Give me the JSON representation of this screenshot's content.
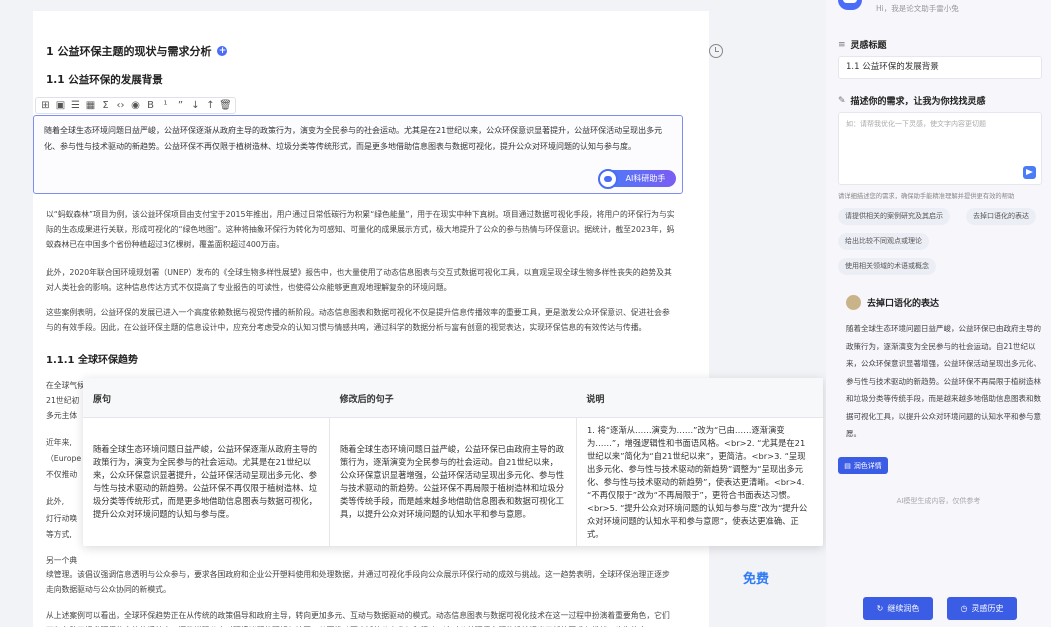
{
  "document": {
    "heading1": "1 公益环保主题的现状与需求分析",
    "heading2": "1.1 公益环保的发展背景",
    "heading3": "1.1.1 全球环保趋势",
    "editor_text": "随着全球生态环境问题日益严峻，公益环保逐渐从政府主导的政策行为，演变为全民参与的社会运动。尤其是在21世纪以来，公众环保意识显著提升，公益环保活动呈现出多元化、参与性与技术驱动的新趋势。公益环保不再仅限于植树造林、垃圾分类等传统形式，而是更多地借助信息图表与数据可视化，提升公众对环境问题的认知与参与度。",
    "ai_button_label": "AI科研助手",
    "para1": "以“蚂蚁森林”项目为例，该公益环保项目由支付宝于2015年推出，用户通过日常低碳行为积累“绿色能量”，用于在现实中种下真树。项目通过数据可视化手段，将用户的环保行为与实际的生态成果进行关联，形成可视化的“绿色地图”。这种将抽象环保行为转化为可感知、可量化的成果展示方式，极大地提升了公众的参与热情与环保意识。据统计，截至2023年，蚂蚁森林已在中国多个省份种植超过3亿棵树，覆盖面积超过400万亩。",
    "para2": "此外，2020年联合国环境规划署（UNEP）发布的《全球生物多样性展望》报告中，也大量使用了动态信息图表与交互式数据可视化工具，以直观呈现全球生物多样性丧失的趋势及其对人类社会的影响。这种信息传达方式不仅提高了专业报告的可读性，也使得公众能够更直观地理解复杂的环境问题。",
    "para3": "这些案例表明，公益环保的发展已进入一个高度依赖数据与视觉传播的新阶段。动态信息图表和数据可视化不仅是提升信息传播效率的重要工具，更是激发公众环保意识、促进社会参与的有效手段。因此，在公益环保主题的信息设计中，应充分考虑受众的认知习惯与情感共鸣，通过科学的数据分析与富有创意的视觉表达，实现环保信息的有效传达与传播。",
    "stub1": "在全球气候变化",
    "stub2": "21世纪初",
    "stub3": "多元主体",
    "stub4": "近年来,",
    "stub5": "（Europe",
    "stub6": "不仅推动",
    "stub7": "此外,",
    "stub8": "灯行动唤",
    "stub9": "等方式,",
    "stub10": "另一个典",
    "para4": "续管理。该倡议强调信息透明与公众参与，要求各国政府和企业公开塑料使用和处理数据，并通过可视化手段向公众展示环保行动的成效与挑战。这一趋势表明，全球环保治理正逐步走向数据驱动与公众协同的新模式。",
    "para5": "从上述案例可以看出，全球环保趋势正在从传统的政策倡导和政府主导，转向更加多元、互动与数据驱动的模式。动态信息图表与数据可视化技术在这一过程中扮演着重要角色，它们不仅有助于提升环保信息的传播效率，还能增强公众对环境议题的理解与认同，从而推动更广泛的公众参与和行动。这对公益环保主题的设计提出了新的要求与挑战，也为信息"
  },
  "comparison": {
    "headers": [
      "原句",
      "修改后的句子",
      "说明"
    ],
    "original": "随着全球生态环境问题日益严峻，公益环保逐渐从政府主导的政策行为，演变为全民参与的社会运动。尤其是在21世纪以来，公众环保意识显著提升，公益环保活动呈现出多元化、参与性与技术驱动的新趋势。公益环保不再仅限于植树造林、垃圾分类等传统形式，而是更多地借助信息图表与数据可视化，提升公众对环境问题的认知与参与度。",
    "revised": "随着全球生态环境问题日益严峻，公益环保已由政府主导的政策行为，逐渐演变为全民参与的社会运动。自21世纪以来，公众环保意识显著增强，公益环保活动呈现出多元化、参与性与技术驱动的新趋势。公益环保不再局限于植树造林和垃圾分类等传统手段，而是越来越多地借助信息图表和数据可视化工具，以提升公众对环境问题的认知水平和参与意愿。",
    "explanation": "1. 将“逐渐从……演变为……”改为“已由……逐渐演变为……”，增强逻辑性和书面语风格。<br>2. “尤其是在21世纪以来”简化为“自21世纪以来”，更简洁。<br>3. “呈现出多元化、参与性与技术驱动的新趋势”调整为“呈现出多元化、参与性与技术驱动的新趋势”，使表达更清晰。<br>4. “不再仅限于”改为“不再局限于”，更符合书面表达习惯。<br>5. “提升公众对环境问题的认知与参与度”改为“提升公众对环境问题的认知水平和参与意愿”，使表达更准确、正式。"
  },
  "free_label": "免费",
  "panel": {
    "greeting": "Hi，我是论文助手雷小兔",
    "inspiration_title_label": "灵感标题",
    "inspiration_title_value": "1.1 公益环保的发展背景",
    "describe_label": "描述你的需求，让我为你找找灵感",
    "describe_placeholder": "如：请帮我优化一下灵感，使文字内容更切题",
    "hint": "请详细描述您的需求，确保助手能精准理解并提供更有效的帮助",
    "chips": [
      "请提供相关的案例研究及其启示",
      "去掉口语化的表达",
      "给出比较不同观点或理论",
      "使用相关领域的术语或概念"
    ],
    "suggestion_title": "去掉口语化的表达",
    "suggestion_text": "随着全球生态环境问题日益严峻，公益环保已由政府主导的政策行为，逐渐演变为全民参与的社会运动。自21世纪以来，公众环保意识显著增强，公益环保活动呈现出多元化、参与性与技术驱动的新趋势。公益环保不再局限于植树造林和垃圾分类等传统手段，而是越来越多地借助信息图表和数据可视化工具，以提升公众对环境问题的认知水平和参与意愿。",
    "polish_detail_label": "润色详情",
    "disclaimer": "AI模型生成内容，仅供参考",
    "continue_label": "继续润色",
    "history_label": "灵感历史"
  }
}
